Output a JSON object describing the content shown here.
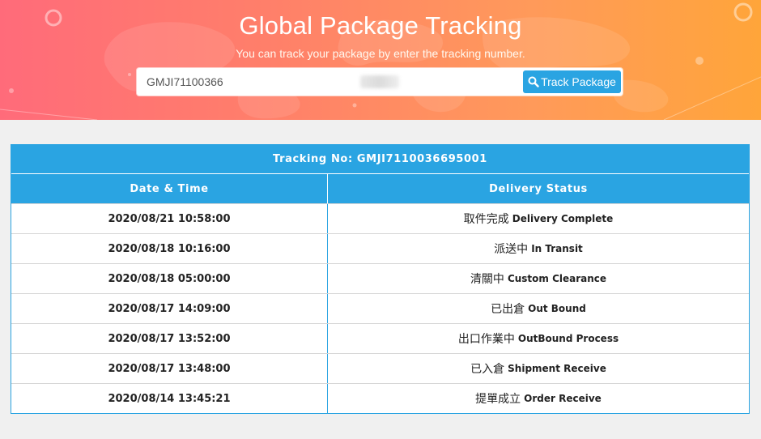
{
  "header": {
    "title": "Global Package Tracking",
    "subtitle": "You can track your package by enter the tracking number.",
    "search": {
      "value": "GMJI71100366",
      "button_label": "Track Package",
      "button_icon": "search-icon"
    }
  },
  "results": {
    "tracking_caption": "Tracking No: GMJI7110036695001",
    "columns": {
      "datetime": "Date & Time",
      "status": "Delivery Status"
    },
    "rows": [
      {
        "datetime": "2020/08/21 10:58:00",
        "status_zh": "取件完成",
        "status_en": "Delivery Complete"
      },
      {
        "datetime": "2020/08/18 10:16:00",
        "status_zh": "派送中",
        "status_en": "In Transit"
      },
      {
        "datetime": "2020/08/18 05:00:00",
        "status_zh": "清關中",
        "status_en": "Custom Clearance"
      },
      {
        "datetime": "2020/08/17 14:09:00",
        "status_zh": "已出倉",
        "status_en": "Out Bound"
      },
      {
        "datetime": "2020/08/17 13:52:00",
        "status_zh": "出口作業中",
        "status_en": "OutBound Process"
      },
      {
        "datetime": "2020/08/17 13:48:00",
        "status_zh": "已入倉",
        "status_en": "Shipment Receive"
      },
      {
        "datetime": "2020/08/14 13:45:21",
        "status_zh": "提單成立",
        "status_en": "Order Receive"
      }
    ]
  },
  "colors": {
    "accent": "#2aa4e2",
    "hero_start": "#ff6b7a",
    "hero_end": "#ffa53a"
  }
}
